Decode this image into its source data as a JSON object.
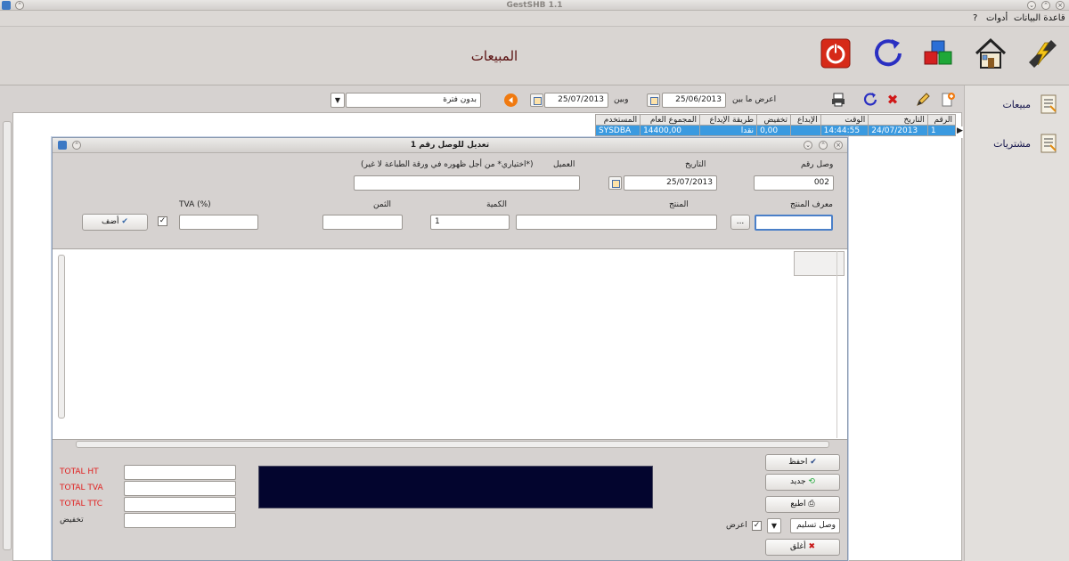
{
  "window": {
    "title": "GestSHB 1.1"
  },
  "menu": {
    "database": "قاعدة البيانات",
    "tools": "أدوات",
    "help": "?"
  },
  "header": {
    "title": "المبيعات",
    "icons": [
      "power-icon",
      "refresh-icon",
      "cubes-icon",
      "home-icon",
      "lightning-icon"
    ]
  },
  "sidebar": {
    "items": [
      {
        "label": "مبيعات",
        "icon": "sales-report-icon"
      },
      {
        "label": "مشتريات",
        "icon": "purchases-report-icon"
      }
    ]
  },
  "toolbar": {
    "period_select": "بدون فترة",
    "show_between": "اعرض ما بين",
    "and": "وبين",
    "date_from": "25/06/2013",
    "date_to": "25/07/2013"
  },
  "sales_table": {
    "headers": [
      "الرقم",
      "التاريخ",
      "الوقت",
      "الإبداع",
      "تخفيض",
      "طريقة الإيداع",
      "المجموع العام",
      "المستخدم"
    ],
    "rows": [
      [
        "1",
        "24/07/2013",
        "14:44:55",
        "",
        "0,00",
        "نقدا",
        "14400,00",
        "SYSDBA"
      ]
    ]
  },
  "dialog": {
    "title": "تعديل للوصل رقم 1",
    "receipt_label": "وصل رقم",
    "receipt_value": "002",
    "date_label": "التاريخ",
    "date_value": "25/07/2013",
    "client_label": "العميل",
    "client_hint": "(*اختياري* من أجل ظهوره في ورقة الطباعة لا غير)",
    "client_value": "",
    "product_id_label": "معرف المنتج",
    "product_id_value": "",
    "browse_label": "...",
    "product_label": "المنتج",
    "product_value": "",
    "quantity_label": "الكمية",
    "quantity_value": "1",
    "price_label": "الثمن",
    "price_value": "",
    "tva_label": "TVA (%)",
    "tva_value": "",
    "add_button": "أضف",
    "totals": {
      "ht": "TOTAL HT",
      "tva": "TOTAL TVA",
      "ttc": "TOTAL TTC",
      "discount": "تخفيض"
    },
    "buttons": {
      "save": "احفظ",
      "new": "جديد",
      "print": "اطبع",
      "close": "أغلق"
    },
    "doc_type": "وصل تسليم",
    "show_label": "اعرض"
  },
  "colors": {
    "selected_row": "#3a9ae0",
    "title_red": "#5a1010",
    "display_bg": "#03052e",
    "totals_red": "#e02020"
  }
}
